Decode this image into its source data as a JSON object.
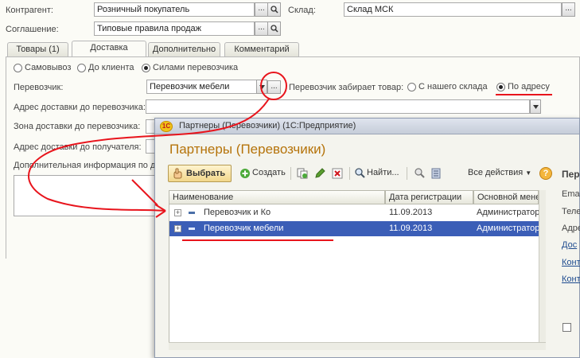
{
  "header": {
    "contractor_label": "Контрагент:",
    "contractor_value": "Розничный покупатель",
    "warehouse_label": "Склад:",
    "warehouse_value": "Склад МСК",
    "agreement_label": "Соглашение:",
    "agreement_value": "Типовые правила продаж"
  },
  "tabs": [
    {
      "label": "Товары (1)",
      "active": false
    },
    {
      "label": "Доставка",
      "active": true
    },
    {
      "label": "Дополнительно",
      "active": false
    },
    {
      "label": "Комментарий",
      "active": false
    }
  ],
  "delivery": {
    "options": [
      "Самовывоз",
      "До клиента",
      "Силами перевозчика"
    ],
    "selected": "Силами перевозчика",
    "carrier_label": "Перевозчик:",
    "carrier_value": "Перевозчик мебели",
    "pickup_label": "Перевозчик забирает товар:",
    "pickup_options": [
      "С нашего склада",
      "По адресу"
    ],
    "pickup_selected": "По адресу",
    "address_label": "Адрес доставки до перевозчика:",
    "zone_label": "Зона доставки до перевозчика:",
    "recipient_address_label": "Адрес доставки до получателя:",
    "extra_info_label": "Дополнительная информация по до"
  },
  "dialog": {
    "window_title": "Партнеры (Перевозчики)  (1С:Предприятие)",
    "heading": "Партнеры (Перевозчики)",
    "toolbar": {
      "select": "Выбрать",
      "create": "Создать",
      "find": "Найти...",
      "all_actions": "Все действия"
    },
    "columns": [
      "Наименование",
      "Дата регистрации",
      "Основной мене"
    ],
    "rows": [
      {
        "name": "Перевозчик и Ко",
        "date": "11.09.2013",
        "manager": "Администратор",
        "selected": false
      },
      {
        "name": "Перевозчик мебели",
        "date": "11.09.2013",
        "manager": "Администратор",
        "selected": true
      }
    ],
    "side_panel": {
      "title": "Пер",
      "fields": [
        "Email",
        "Теле",
        "Адре"
      ],
      "links": [
        "Дос",
        "Конт",
        "Конт"
      ]
    }
  },
  "colors": {
    "accent_title": "#b5730a",
    "selection": "#3b5eb7",
    "annotation": "#e8141c"
  }
}
